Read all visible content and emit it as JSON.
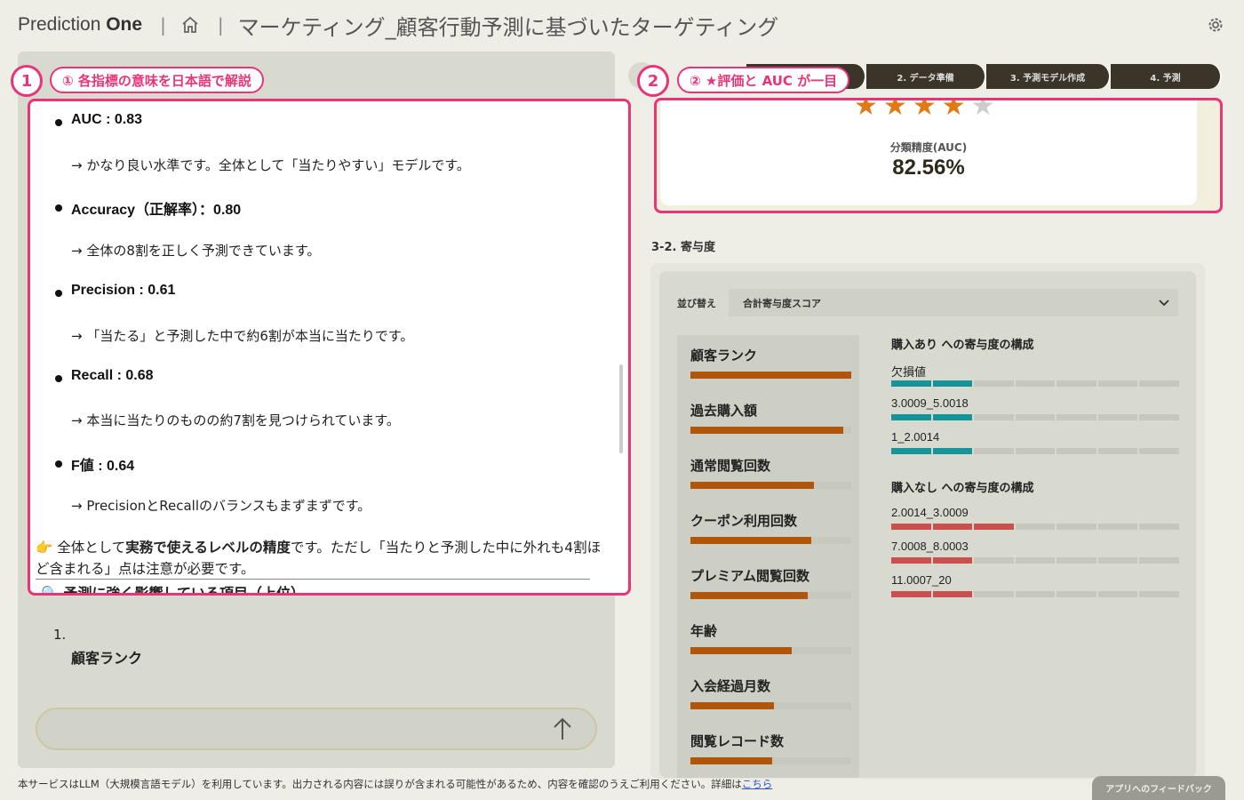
{
  "header": {
    "logo_light": "Prediction ",
    "logo_bold": "One",
    "separator": "|",
    "title": "マーケティング_顧客行動予測に基づいたターゲティング"
  },
  "callouts": {
    "one_num": "1",
    "one_label": "① 各指標の意味を日本語で解説",
    "two_num": "2",
    "two_label": "② ★評価と AUC が一目"
  },
  "metrics": [
    {
      "name": "AUC : 0.83",
      "desc": "→ かなり良い水準です。全体として「当たりやすい」モデルです。"
    },
    {
      "name": "Accuracy（正解率）：0.80",
      "desc": "→ 全体の8割を正しく予測できています。"
    },
    {
      "name": "Precision : 0.61",
      "desc": "→ 「当たる」と予測した中で約6割が本当に当たりです。"
    },
    {
      "name": "Recall : 0.68",
      "desc": "→ 本当に当たりのものの約7割を見つけられています。"
    },
    {
      "name": "F値 : 0.64",
      "desc": "→ PrecisionとRecallのバランスもまずまずです。"
    }
  ],
  "summary": {
    "icon": "👉",
    "pre": " 全体として",
    "bold": "実務で使えるレベルの精度",
    "post": "です。ただし「当たりと予測した中に外れも4割ほど含まれる」点は注意が必要です。"
  },
  "influence_heading": "🔍 予測に強く影響している項目（上位）",
  "numbered_list": {
    "num": "1.",
    "item": "顧客ランク"
  },
  "steps": [
    "2. データ準備",
    "3. 予測モデル作成",
    "4. 予測"
  ],
  "rating": {
    "stars_filled": 4,
    "stars_total": 5
  },
  "auc": {
    "label": "分類精度(AUC)",
    "value": "82.56%"
  },
  "contrib": {
    "section_title": "3-2. 寄与度",
    "sort_label": "並び替え",
    "sort_value": "合計寄与度スコア",
    "features": [
      {
        "name": "顧客ランク",
        "value": 1.0
      },
      {
        "name": "過去購入額",
        "value": 0.95
      },
      {
        "name": "通常閲覧回数",
        "value": 0.77
      },
      {
        "name": "クーポン利用回数",
        "value": 0.75
      },
      {
        "name": "プレミアム閲覧回数",
        "value": 0.73
      },
      {
        "name": "年齢",
        "value": 0.63
      },
      {
        "name": "入会経過月数",
        "value": 0.52
      },
      {
        "name": "閲覧レコード数",
        "value": 0.51
      }
    ],
    "groups": [
      {
        "title": "購入あり への寄与度の構成",
        "color": "#17949a",
        "rows": [
          {
            "label": "欠損値",
            "filled": 2
          },
          {
            "label": "3.0009_5.0018",
            "filled": 2
          },
          {
            "label": "1_2.0014",
            "filled": 2
          }
        ]
      },
      {
        "title": "購入なし への寄与度の構成",
        "color": "#c9504f",
        "rows": [
          {
            "label": "2.0014_3.0009",
            "filled": 3
          },
          {
            "label": "7.0008_8.0003",
            "filled": 2
          },
          {
            "label": "11.0007_20",
            "filled": 2
          }
        ]
      }
    ]
  },
  "footer": {
    "text": "本サービスはLLM（大規模言語モデル）を利用しています。出力される内容には誤りが含まれる可能性があるため、内容を確認のうえご利用ください。詳細は",
    "link": "こちら",
    "feedback": "アプリへのフィードバック"
  },
  "colors": {
    "accent": "#e8357a",
    "star": "#e07a17",
    "star_empty": "#cccccc",
    "bar": "#b0560b"
  }
}
